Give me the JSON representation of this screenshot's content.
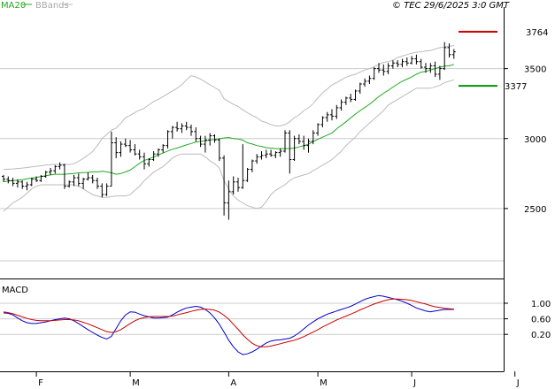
{
  "header": {
    "legend_ma": "MA20",
    "legend_bb": "BBands",
    "copyright": "© TEC 29/6/2025 3:0 GMT"
  },
  "colors": {
    "ma": "#22aa22",
    "bands": "#bbbbbb",
    "price": "#000000",
    "resistance": "#cc0000",
    "support": "#009900",
    "macd": "#0000cc",
    "signal": "#cc0000",
    "grid": "#cccccc"
  },
  "chart_data": [
    {
      "type": "ohlc",
      "title": "",
      "y_ticks": [
        2500,
        3000,
        3500
      ],
      "ylim": [
        2000,
        3940
      ],
      "x_ticks": [
        {
          "label": "F",
          "index": 7
        },
        {
          "label": "M",
          "index": 27
        },
        {
          "label": "A",
          "index": 48
        },
        {
          "label": "M",
          "index": 67
        },
        {
          "label": "J",
          "index": 87
        },
        {
          "label": "J",
          "index": 109
        }
      ],
      "levels": [
        {
          "name": "resistance",
          "value": 3764,
          "label": "3764"
        },
        {
          "name": "support",
          "value": 3377,
          "label": "3377"
        }
      ],
      "series": [
        {
          "name": "MA20",
          "values": [
            2692,
            2696,
            2700,
            2702,
            2706,
            2712,
            2718,
            2723,
            2729,
            2735,
            2740,
            2745,
            2745,
            2745,
            2748,
            2751,
            2755,
            2757,
            2758,
            2762,
            2762,
            2766,
            2762,
            2755,
            2745,
            2750,
            2762,
            2775,
            2799,
            2824,
            2844,
            2855,
            2869,
            2883,
            2897,
            2911,
            2924,
            2933,
            2944,
            2955,
            2965,
            2976,
            2980,
            2984,
            2989,
            2994,
            2999,
            3004,
            3008,
            3000,
            2998,
            2989,
            2970,
            2961,
            2950,
            2944,
            2935,
            2932,
            2928,
            2928,
            2928,
            2929,
            2932,
            2940,
            2950,
            2960,
            2979,
            2995,
            3010,
            3025,
            3040,
            3070,
            3095,
            3120,
            3148,
            3175,
            3200,
            3222,
            3245,
            3272,
            3300,
            3324,
            3345,
            3368,
            3390,
            3410,
            3425,
            3440,
            3460,
            3475,
            3480,
            3490,
            3500,
            3510,
            3518,
            3520,
            3530
          ]
        },
        {
          "name": "BBands-upper",
          "values": [
            2780,
            2781,
            2783,
            2786,
            2789,
            2793,
            2798,
            2802,
            2806,
            2810,
            2814,
            2815,
            2815,
            2815,
            2815,
            2820,
            2838,
            2858,
            2882,
            2908,
            2950,
            3000,
            3030,
            3060,
            3075,
            3110,
            3150,
            3165,
            3187,
            3203,
            3216,
            3242,
            3265,
            3280,
            3300,
            3320,
            3340,
            3360,
            3385,
            3420,
            3450,
            3440,
            3425,
            3405,
            3385,
            3365,
            3345,
            3285,
            3265,
            3245,
            3230,
            3205,
            3185,
            3165,
            3150,
            3125,
            3115,
            3100,
            3090,
            3090,
            3100,
            3120,
            3150,
            3170,
            3200,
            3220,
            3250,
            3290,
            3327,
            3354,
            3384,
            3400,
            3420,
            3438,
            3450,
            3460,
            3475,
            3490,
            3500,
            3515,
            3530,
            3545,
            3550,
            3560,
            3580,
            3590,
            3600,
            3610,
            3617,
            3620,
            3625,
            3630,
            3640,
            3650,
            3655,
            3660,
            3665
          ]
        },
        {
          "name": "BBands-lower",
          "values": [
            2480,
            2510,
            2540,
            2560,
            2580,
            2610,
            2640,
            2660,
            2670,
            2670,
            2670,
            2670,
            2670,
            2670,
            2670,
            2670,
            2660,
            2640,
            2620,
            2600,
            2590,
            2580,
            2580,
            2585,
            2590,
            2590,
            2590,
            2600,
            2630,
            2660,
            2700,
            2730,
            2760,
            2780,
            2800,
            2830,
            2860,
            2880,
            2890,
            2890,
            2890,
            2890,
            2890,
            2870,
            2840,
            2820,
            2790,
            2700,
            2640,
            2590,
            2560,
            2540,
            2520,
            2510,
            2500,
            2510,
            2550,
            2600,
            2630,
            2650,
            2670,
            2700,
            2720,
            2730,
            2740,
            2750,
            2770,
            2790,
            2810,
            2830,
            2850,
            2880,
            2910,
            2950,
            2980,
            3010,
            3050,
            3080,
            3110,
            3140,
            3170,
            3200,
            3240,
            3260,
            3280,
            3300,
            3320,
            3340,
            3360,
            3360,
            3360,
            3360,
            3370,
            3380,
            3400,
            3410,
            3420
          ]
        }
      ],
      "ohlc": [
        [
          2730,
          2740,
          2690,
          2710
        ],
        [
          2710,
          2730,
          2680,
          2700
        ],
        [
          2700,
          2720,
          2660,
          2680
        ],
        [
          2680,
          2710,
          2650,
          2690
        ],
        [
          2690,
          2700,
          2640,
          2660
        ],
        [
          2660,
          2690,
          2630,
          2670
        ],
        [
          2670,
          2720,
          2660,
          2710
        ],
        [
          2710,
          2730,
          2690,
          2700
        ],
        [
          2700,
          2740,
          2690,
          2730
        ],
        [
          2730,
          2770,
          2720,
          2760
        ],
        [
          2760,
          2790,
          2740,
          2770
        ],
        [
          2770,
          2810,
          2750,
          2800
        ],
        [
          2800,
          2830,
          2780,
          2810
        ],
        [
          2810,
          2820,
          2640,
          2660
        ],
        [
          2660,
          2700,
          2650,
          2690
        ],
        [
          2690,
          2740,
          2660,
          2720
        ],
        [
          2720,
          2750,
          2660,
          2680
        ],
        [
          2680,
          2720,
          2640,
          2710
        ],
        [
          2710,
          2760,
          2700,
          2720
        ],
        [
          2720,
          2740,
          2680,
          2700
        ],
        [
          2700,
          2720,
          2640,
          2660
        ],
        [
          2660,
          2680,
          2580,
          2600
        ],
        [
          2600,
          2680,
          2590,
          2660
        ],
        [
          2660,
          3050,
          2660,
          2970
        ],
        [
          2970,
          3010,
          2860,
          2900
        ],
        [
          2900,
          2980,
          2870,
          2960
        ],
        [
          2960,
          3000,
          2940,
          2950
        ],
        [
          2950,
          2990,
          2900,
          2920
        ],
        [
          2920,
          2960,
          2880,
          2890
        ],
        [
          2890,
          2920,
          2850,
          2870
        ],
        [
          2870,
          2900,
          2780,
          2820
        ],
        [
          2820,
          2860,
          2800,
          2850
        ],
        [
          2850,
          2910,
          2840,
          2890
        ],
        [
          2890,
          2930,
          2870,
          2920
        ],
        [
          2920,
          2960,
          2900,
          2950
        ],
        [
          2950,
          3060,
          2930,
          3050
        ],
        [
          3050,
          3090,
          3000,
          3080
        ],
        [
          3080,
          3120,
          3050,
          3070
        ],
        [
          3070,
          3110,
          3040,
          3090
        ],
        [
          3090,
          3120,
          3060,
          3080
        ],
        [
          3080,
          3100,
          3020,
          3050
        ],
        [
          3050,
          3080,
          2980,
          3000
        ],
        [
          3000,
          3020,
          2940,
          2960
        ],
        [
          2960,
          3020,
          2900,
          2990
        ],
        [
          2990,
          3040,
          2950,
          3020
        ],
        [
          3020,
          3030,
          2970,
          2990
        ],
        [
          2990,
          3000,
          2840,
          2860
        ],
        [
          2860,
          2880,
          2450,
          2540
        ],
        [
          2540,
          2700,
          2420,
          2620
        ],
        [
          2620,
          2730,
          2600,
          2690
        ],
        [
          2690,
          2720,
          2620,
          2650
        ],
        [
          2650,
          2960,
          2640,
          2700
        ],
        [
          2700,
          2790,
          2690,
          2780
        ],
        [
          2780,
          2850,
          2760,
          2840
        ],
        [
          2840,
          2890,
          2820,
          2870
        ],
        [
          2870,
          2910,
          2850,
          2880
        ],
        [
          2880,
          2920,
          2860,
          2890
        ],
        [
          2890,
          2920,
          2870,
          2880
        ],
        [
          2880,
          2910,
          2860,
          2900
        ],
        [
          2900,
          2930,
          2870,
          2910
        ],
        [
          2910,
          3060,
          2900,
          3040
        ],
        [
          3040,
          3060,
          2750,
          2850
        ],
        [
          2850,
          3020,
          2840,
          3000
        ],
        [
          3000,
          3030,
          2960,
          2980
        ],
        [
          2980,
          3020,
          2920,
          2950
        ],
        [
          2950,
          3000,
          2900,
          2980
        ],
        [
          2980,
          3060,
          2960,
          3040
        ],
        [
          3040,
          3110,
          3020,
          3100
        ],
        [
          3100,
          3160,
          3080,
          3150
        ],
        [
          3150,
          3190,
          3120,
          3170
        ],
        [
          3170,
          3210,
          3130,
          3160
        ],
        [
          3160,
          3240,
          3140,
          3220
        ],
        [
          3220,
          3280,
          3200,
          3260
        ],
        [
          3260,
          3300,
          3240,
          3290
        ],
        [
          3290,
          3320,
          3260,
          3280
        ],
        [
          3280,
          3350,
          3270,
          3340
        ],
        [
          3340,
          3400,
          3320,
          3390
        ],
        [
          3390,
          3430,
          3370,
          3410
        ],
        [
          3410,
          3450,
          3390,
          3430
        ],
        [
          3430,
          3510,
          3420,
          3500
        ],
        [
          3500,
          3540,
          3470,
          3490
        ],
        [
          3490,
          3530,
          3450,
          3480
        ],
        [
          3480,
          3540,
          3460,
          3520
        ],
        [
          3520,
          3560,
          3500,
          3540
        ],
        [
          3540,
          3560,
          3510,
          3530
        ],
        [
          3530,
          3570,
          3510,
          3550
        ],
        [
          3550,
          3580,
          3520,
          3540
        ],
        [
          3540,
          3590,
          3530,
          3570
        ],
        [
          3570,
          3600,
          3530,
          3550
        ],
        [
          3550,
          3570,
          3500,
          3510
        ],
        [
          3510,
          3540,
          3470,
          3500
        ],
        [
          3500,
          3540,
          3470,
          3520
        ],
        [
          3520,
          3550,
          3440,
          3460
        ],
        [
          3460,
          3520,
          3420,
          3500
        ],
        [
          3500,
          3690,
          3490,
          3650
        ],
        [
          3650,
          3680,
          3580,
          3600
        ],
        [
          3600,
          3640,
          3570,
          3620
        ]
      ]
    },
    {
      "type": "line",
      "title": "MACD",
      "y_ticks": [
        "1.00",
        "0.60",
        "0.20"
      ],
      "series": [
        {
          "name": "MACD",
          "values": [
            0.75,
            0.74,
            0.7,
            0.62,
            0.55,
            0.5,
            0.48,
            0.48,
            0.5,
            0.52,
            0.55,
            0.58,
            0.6,
            0.62,
            0.6,
            0.55,
            0.48,
            0.4,
            0.32,
            0.25,
            0.18,
            0.12,
            0.08,
            0.15,
            0.35,
            0.55,
            0.7,
            0.78,
            0.77,
            0.72,
            0.68,
            0.65,
            0.62,
            0.62,
            0.63,
            0.64,
            0.7,
            0.77,
            0.83,
            0.88,
            0.9,
            0.92,
            0.9,
            0.84,
            0.75,
            0.62,
            0.46,
            0.26,
            0.05,
            -0.12,
            -0.25,
            -0.32,
            -0.3,
            -0.25,
            -0.18,
            -0.1,
            -0.02,
            0.03,
            0.05,
            0.06,
            0.08,
            0.1,
            0.16,
            0.24,
            0.34,
            0.44,
            0.52,
            0.6,
            0.66,
            0.72,
            0.76,
            0.8,
            0.84,
            0.88,
            0.92,
            0.98,
            1.04,
            1.1,
            1.14,
            1.17,
            1.2,
            1.18,
            1.15,
            1.12,
            1.09,
            1.05,
            1.0,
            0.94,
            0.88,
            0.84,
            0.8,
            0.78,
            0.8,
            0.82,
            0.84,
            0.84,
            0.84
          ]
        },
        {
          "name": "Signal",
          "values": [
            0.78,
            0.76,
            0.73,
            0.69,
            0.65,
            0.61,
            0.58,
            0.56,
            0.55,
            0.55,
            0.55,
            0.56,
            0.57,
            0.58,
            0.58,
            0.57,
            0.55,
            0.51,
            0.47,
            0.42,
            0.37,
            0.32,
            0.27,
            0.25,
            0.27,
            0.32,
            0.4,
            0.48,
            0.55,
            0.6,
            0.63,
            0.65,
            0.66,
            0.66,
            0.66,
            0.66,
            0.67,
            0.7,
            0.73,
            0.76,
            0.79,
            0.82,
            0.84,
            0.85,
            0.84,
            0.82,
            0.77,
            0.69,
            0.59,
            0.46,
            0.33,
            0.19,
            0.07,
            -0.03,
            -0.09,
            -0.12,
            -0.12,
            -0.1,
            -0.07,
            -0.04,
            -0.01,
            0.02,
            0.05,
            0.09,
            0.14,
            0.2,
            0.26,
            0.32,
            0.39,
            0.45,
            0.51,
            0.57,
            0.62,
            0.67,
            0.72,
            0.77,
            0.83,
            0.88,
            0.93,
            0.98,
            1.02,
            1.06,
            1.09,
            1.11,
            1.11,
            1.1,
            1.09,
            1.07,
            1.04,
            1.01,
            0.98,
            0.94,
            0.91,
            0.89,
            0.87,
            0.86,
            0.85
          ]
        }
      ]
    }
  ]
}
